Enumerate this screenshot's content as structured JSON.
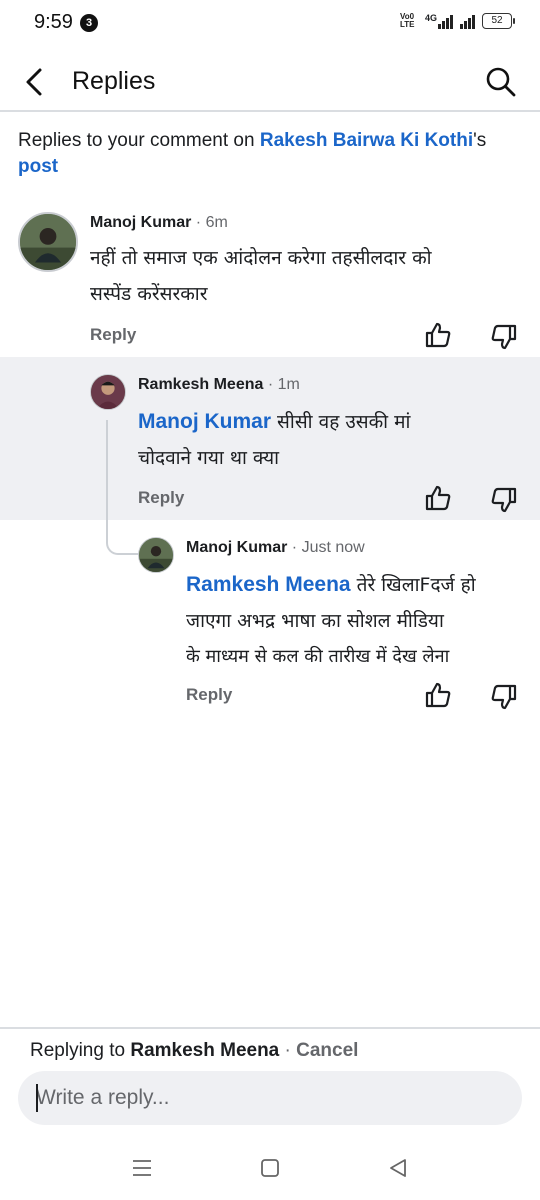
{
  "status_bar": {
    "time": "9:59",
    "notification_count": "3",
    "network_label_1": "Vo0",
    "network_label_2": "LTE",
    "network_type": "4G",
    "battery": "52"
  },
  "header": {
    "title": "Replies",
    "back_icon": "back-arrow-icon",
    "search_icon": "search-icon"
  },
  "intro": {
    "prefix": "Replies to your comment on ",
    "page_name": "Rakesh Bairwa Ki Kothi",
    "suffix": "'s",
    "post_link": "post"
  },
  "comments": [
    {
      "author": "Manoj Kumar",
      "time": "· 6m",
      "mention": "",
      "text_line1": "नहीं तो समाज एक आंदोलन करेगा तहसीलदार को",
      "text_line2": "सस्पेंड करेंसरकार",
      "reply_label": "Reply"
    },
    {
      "author": "Ramkesh Meena",
      "time": "· 1m",
      "mention": "Manoj Kumar",
      "text_line1": " सीसी वह उसकी मां",
      "text_line2": "चोदवाने गया था क्या",
      "reply_label": "Reply"
    },
    {
      "author": "Manoj Kumar",
      "time": "· Just now",
      "mention": "Ramkesh Meena",
      "text_line1": " तेरे खिलाFदर्ज हो",
      "text_line2": "जाएगा अभद्र भाषा का सोशल मीडिया",
      "text_line3": "के माध्यम से कल की तारीख में देख लेना",
      "reply_label": "Reply"
    }
  ],
  "composer": {
    "replying_prefix": "Replying to ",
    "replying_to": "Ramkesh Meena",
    "separator": " · ",
    "cancel_label": "Cancel",
    "placeholder": "Write a reply..."
  },
  "colors": {
    "link_blue": "#1b66c9",
    "muted_gray": "#65676b",
    "highlight_bg": "#eff0f3"
  }
}
